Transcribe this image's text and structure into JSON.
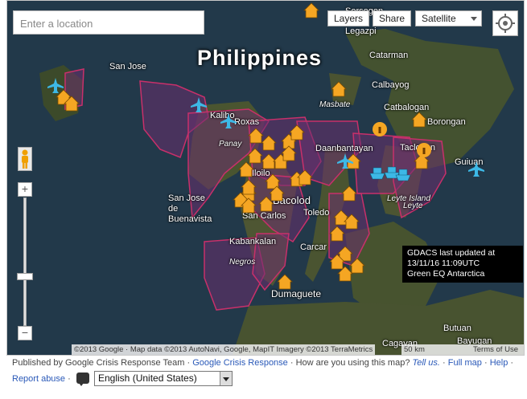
{
  "search": {
    "placeholder": "Enter a location"
  },
  "map_controls": {
    "layers_label": "Layers",
    "share_label": "Share",
    "map_type_selected": "Satellite"
  },
  "map": {
    "title": "Philippines",
    "places": [
      {
        "name": "San Jose"
      },
      {
        "name": "Kalibo"
      },
      {
        "name": "Roxas"
      },
      {
        "name": "Panay"
      },
      {
        "name": "Iloilo"
      },
      {
        "name": "San Jose de Buenavista"
      },
      {
        "name": "Bacolod"
      },
      {
        "name": "San Carlos"
      },
      {
        "name": "Toledo"
      },
      {
        "name": "Kabankalan"
      },
      {
        "name": "Negros"
      },
      {
        "name": "Carcar"
      },
      {
        "name": "Dumaguete"
      },
      {
        "name": "Daanbantayan"
      },
      {
        "name": "Masbate"
      },
      {
        "name": "Calbayog"
      },
      {
        "name": "Catbalogan"
      },
      {
        "name": "Catarman"
      },
      {
        "name": "Borongan"
      },
      {
        "name": "Tacloban"
      },
      {
        "name": "Guiuan"
      },
      {
        "name": "Leyte Island"
      },
      {
        "name": "Leyte"
      },
      {
        "name": "Cagayan"
      },
      {
        "name": "Butuan"
      },
      {
        "name": "Bayugan"
      },
      {
        "name": "Sorsogon"
      },
      {
        "name": "Legazpi"
      }
    ]
  },
  "zoom": {
    "plus": "+",
    "minus": "−"
  },
  "gdacs": {
    "line1": "GDACS last updated at",
    "line2": "13/11/16 11:09UTC",
    "line3": "Green EQ Antarctica"
  },
  "attribution": {
    "text": "©2013 Google · Map data ©2013 AutoNavi, Google, MapIT Imagery ©2013 TerraMetrics",
    "scale": "50 km",
    "terms": "Terms of Use"
  },
  "footer": {
    "published_by": "Published by Google Crisis Response Team · ",
    "gcr_link": "Google Crisis Response",
    "question": " · How are you using this map? ",
    "tell_us": "Tell us.",
    "sep1": " · ",
    "full_map": "Full map",
    "sep2": " · ",
    "help": "Help",
    "sep3": " ·",
    "report_abuse": "Report abuse",
    "sep4": " ·",
    "language_selected": "English (United States)"
  },
  "colors": {
    "region_fill": "#6a2f6e",
    "region_stroke": "#c8306a",
    "marker_orange": "#f5a623",
    "marker_blue": "#3db8e6"
  }
}
